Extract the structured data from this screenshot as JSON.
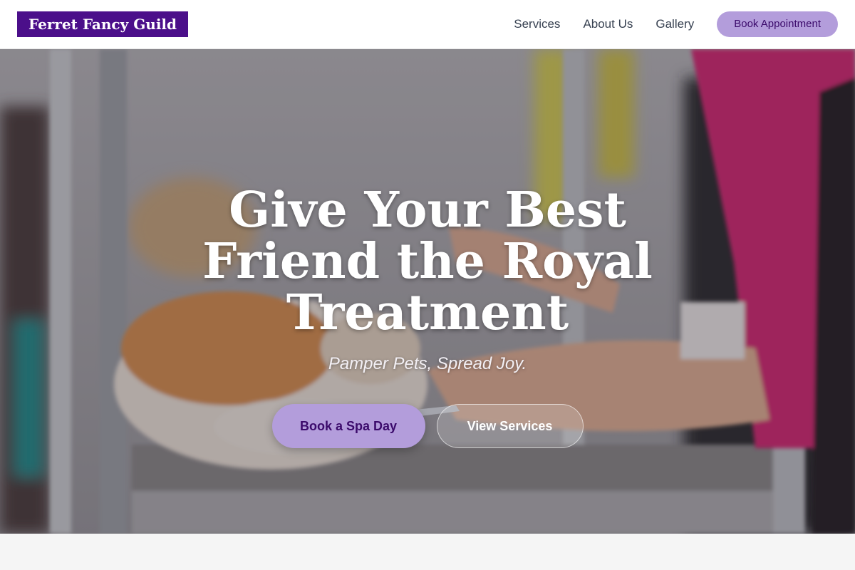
{
  "header": {
    "logo": "Ferret Fancy Guild",
    "nav": [
      {
        "label": "Services"
      },
      {
        "label": "About Us"
      },
      {
        "label": "Gallery"
      }
    ],
    "cta": "Book Appointment"
  },
  "hero": {
    "title": "Give Your Best Friend the Royal Treatment",
    "subtitle": "Pamper Pets, Spread Joy.",
    "primary_button": "Book a Spa Day",
    "secondary_button": "View Services",
    "image_alt": "Groomer brushing a fluffy orange and white cat in a grooming station"
  },
  "colors": {
    "brand": "#4b0f8a",
    "accent": "#b39ddb",
    "accent_text": "#3b0a6b"
  }
}
